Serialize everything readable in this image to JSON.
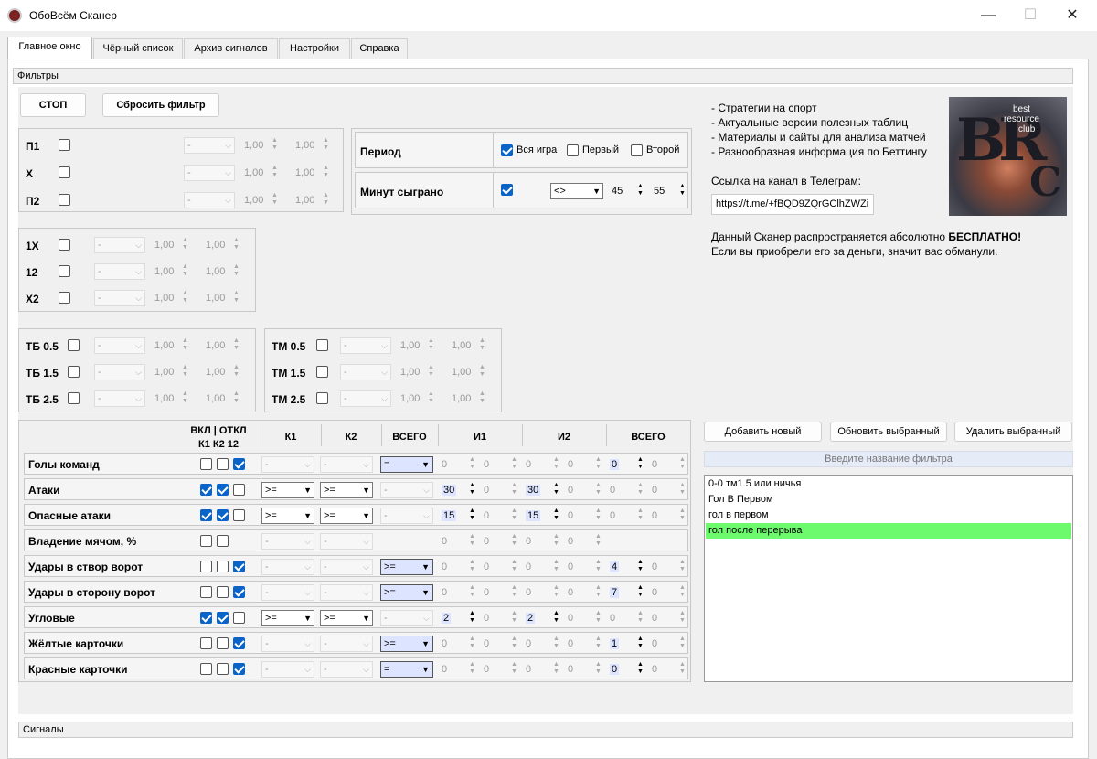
{
  "window": {
    "title": "ОбоВсём Сканер",
    "minimize": "—",
    "maximize": "☐",
    "close": "✕"
  },
  "tabs": [
    "Главное окно",
    "Чёрный список",
    "Архив сигналов",
    "Настройки",
    "Справка"
  ],
  "filters_header": "Фильтры",
  "signals_header": "Сигналы",
  "buttons": {
    "stop": "СТОП",
    "reset": "Сбросить фильтр",
    "add": "Добавить новый",
    "update": "Обновить выбранный",
    "delete": "Удалить выбранный"
  },
  "outcomes_1": [
    {
      "label": "П1",
      "select": "-",
      "v1": "1,00",
      "v2": "1,00"
    },
    {
      "label": "Х",
      "select": "-",
      "v1": "1,00",
      "v2": "1,00"
    },
    {
      "label": "П2",
      "select": "-",
      "v1": "1,00",
      "v2": "1,00"
    }
  ],
  "outcomes_2": [
    {
      "label": "1Х",
      "select": "-",
      "v1": "1,00",
      "v2": "1,00"
    },
    {
      "label": "12",
      "select": "-",
      "v1": "1,00",
      "v2": "1,00"
    },
    {
      "label": "Х2",
      "select": "-",
      "v1": "1,00",
      "v2": "1,00"
    }
  ],
  "totals_over": [
    {
      "label": "ТБ 0.5",
      "select": "-",
      "v1": "1,00",
      "v2": "1,00"
    },
    {
      "label": "ТБ 1.5",
      "select": "-",
      "v1": "1,00",
      "v2": "1,00"
    },
    {
      "label": "ТБ 2.5",
      "select": "-",
      "v1": "1,00",
      "v2": "1,00"
    }
  ],
  "totals_under": [
    {
      "label": "ТМ 0.5",
      "select": "-",
      "v1": "1,00",
      "v2": "1,00"
    },
    {
      "label": "ТМ 1.5",
      "select": "-",
      "v1": "1,00",
      "v2": "1,00"
    },
    {
      "label": "ТМ 2.5",
      "select": "-",
      "v1": "1,00",
      "v2": "1,00"
    }
  ],
  "period": {
    "label": "Период",
    "options": [
      {
        "label": "Вся игра",
        "checked": true
      },
      {
        "label": "Первый",
        "checked": false
      },
      {
        "label": "Второй",
        "checked": false
      }
    ]
  },
  "minutes": {
    "label": "Минут сыграно",
    "checked": true,
    "op": "<>",
    "from": "45",
    "to": "55"
  },
  "info": {
    "bullets": [
      "- Стратегии на спорт",
      "- Актуальные версии полезных таблиц",
      "- Материалы и сайты для анализа матчей",
      "- Разнообразная информация по Беттингу"
    ],
    "link_label": "Ссылка на канал в Телеграм:",
    "link_value": "https://t.me/+fBQD9ZQrGClhZWZi",
    "free_prefix": "Данный Сканер распространяется абсолютно ",
    "free_bold": "БЕСПЛАТНО!",
    "warning": "Если вы приобрели его за деньги, значит вас обманули.",
    "logo_big": "BR",
    "logo_c": "C",
    "logo_words": [
      "best",
      "resource",
      "club"
    ]
  },
  "stats_header": {
    "toggle_top": "ВКЛ | ОТКЛ",
    "toggle_bottom": "К1 К2 12",
    "k1": "К1",
    "k2": "К2",
    "total": "ВСЕГО",
    "i1": "И1",
    "i2": "И2",
    "total2": "ВСЕГО"
  },
  "stats_rows": [
    {
      "label": "Голы команд",
      "c1": false,
      "c2": false,
      "c3": true,
      "k1": "-",
      "k2": "-",
      "tot": "=",
      "i1a": "0",
      "i1b": "0",
      "i2a": "0",
      "i2b": "0",
      "sa": "0",
      "sb": "0"
    },
    {
      "label": "Атаки",
      "c1": true,
      "c2": true,
      "c3": false,
      "k1": ">=",
      "k2": ">=",
      "tot": "-",
      "i1a": "30",
      "i1b": "0",
      "i2a": "30",
      "i2b": "0",
      "sa": "0",
      "sb": "0"
    },
    {
      "label": "Опасные атаки",
      "c1": true,
      "c2": true,
      "c3": false,
      "k1": ">=",
      "k2": ">=",
      "tot": "-",
      "i1a": "15",
      "i1b": "0",
      "i2a": "15",
      "i2b": "0",
      "sa": "0",
      "sb": "0"
    },
    {
      "label": "Владение мячом, %",
      "c1": false,
      "c2": false,
      "c3": null,
      "k1": "-",
      "k2": "-",
      "tot": "",
      "i1a": "0",
      "i1b": "0",
      "i2a": "0",
      "i2b": "0",
      "sa": "",
      "sb": ""
    },
    {
      "label": "Удары в створ ворот",
      "c1": false,
      "c2": false,
      "c3": true,
      "k1": "-",
      "k2": "-",
      "tot": ">=",
      "i1a": "0",
      "i1b": "0",
      "i2a": "0",
      "i2b": "0",
      "sa": "4",
      "sb": "0"
    },
    {
      "label": "Удары в сторону ворот",
      "c1": false,
      "c2": false,
      "c3": true,
      "k1": "-",
      "k2": "-",
      "tot": ">=",
      "i1a": "0",
      "i1b": "0",
      "i2a": "0",
      "i2b": "0",
      "sa": "7",
      "sb": "0"
    },
    {
      "label": "Угловые",
      "c1": true,
      "c2": true,
      "c3": false,
      "k1": ">=",
      "k2": ">=",
      "tot": "-",
      "i1a": "2",
      "i1b": "0",
      "i2a": "2",
      "i2b": "0",
      "sa": "0",
      "sb": "0"
    },
    {
      "label": "Жёлтые карточки",
      "c1": false,
      "c2": false,
      "c3": true,
      "k1": "-",
      "k2": "-",
      "tot": ">=",
      "i1a": "0",
      "i1b": "0",
      "i2a": "0",
      "i2b": "0",
      "sa": "1",
      "sb": "0"
    },
    {
      "label": "Красные карточки",
      "c1": false,
      "c2": false,
      "c3": true,
      "k1": "-",
      "k2": "-",
      "tot": "=",
      "i1a": "0",
      "i1b": "0",
      "i2a": "0",
      "i2b": "0",
      "sa": "0",
      "sb": "0"
    }
  ],
  "filter_name_placeholder": "Введите название фильтра",
  "saved_filters": [
    {
      "name": "0-0 тм1.5 или ничья",
      "selected": false
    },
    {
      "name": "Гол В Первом",
      "selected": false
    },
    {
      "name": "гол в первом",
      "selected": false
    },
    {
      "name": "гол после перерыва",
      "selected": true
    }
  ]
}
